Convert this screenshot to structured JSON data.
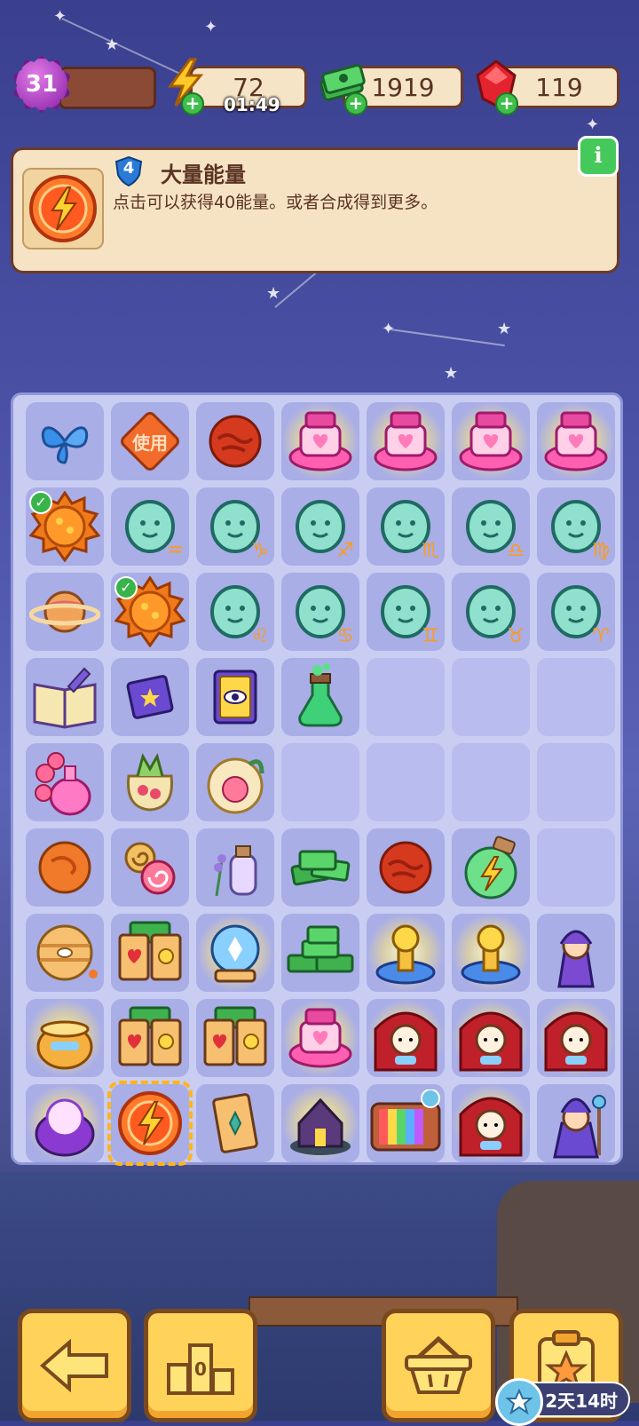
{
  "top_bar": {
    "level": "31",
    "energy": "72",
    "energy_timer": "01:49",
    "cash": "1919",
    "gems": "119"
  },
  "info_panel": {
    "item_level": "4",
    "title": "大量能量",
    "description": "点击可以获得40能量。或者合成得到更多。",
    "info_button": "i"
  },
  "board": {
    "rows": [
      [
        {
          "name": "blue-butterfly",
          "icon": "butterfly"
        },
        {
          "name": "use-card",
          "icon": "ticket",
          "text": "使用"
        },
        {
          "name": "red-planet",
          "icon": "planet-red"
        },
        {
          "name": "pink-heart-chest",
          "icon": "chest",
          "glow": true
        },
        {
          "name": "pink-heart-chest",
          "icon": "chest",
          "glow": true
        },
        {
          "name": "pink-heart-chest",
          "icon": "chest",
          "glow": true
        },
        {
          "name": "pink-heart-chest",
          "icon": "chest",
          "glow": true
        }
      ],
      [
        {
          "name": "sun",
          "icon": "sun",
          "check": true
        },
        {
          "name": "aquarius-statue",
          "icon": "zodiac",
          "symbol": "♒"
        },
        {
          "name": "capricorn-statue",
          "icon": "zodiac",
          "symbol": "♑"
        },
        {
          "name": "sagittarius-statue",
          "icon": "zodiac",
          "symbol": "♐"
        },
        {
          "name": "scorpio-statue",
          "icon": "zodiac",
          "symbol": "♏"
        },
        {
          "name": "libra-statue",
          "icon": "zodiac",
          "symbol": "♎"
        },
        {
          "name": "virgo-statue",
          "icon": "zodiac",
          "symbol": "♍"
        }
      ],
      [
        {
          "name": "saturn",
          "icon": "saturn"
        },
        {
          "name": "sun",
          "icon": "sun",
          "check": true
        },
        {
          "name": "leo-statue",
          "icon": "zodiac",
          "symbol": "♌"
        },
        {
          "name": "cancer-statue",
          "icon": "zodiac",
          "symbol": "♋"
        },
        {
          "name": "gemini-statue",
          "icon": "zodiac",
          "symbol": "♊"
        },
        {
          "name": "taurus-statue",
          "icon": "zodiac",
          "symbol": "♉"
        },
        {
          "name": "aries-statue",
          "icon": "zodiac",
          "symbol": "♈"
        }
      ],
      [
        {
          "name": "magic-book-open",
          "icon": "book-open"
        },
        {
          "name": "purple-book",
          "icon": "book"
        },
        {
          "name": "eye-book",
          "icon": "eye-book"
        },
        {
          "name": "green-potion",
          "icon": "potion-green"
        },
        {
          "name": "empty",
          "empty": true
        },
        {
          "name": "empty",
          "empty": true
        },
        {
          "name": "empty",
          "empty": true
        }
      ],
      [
        {
          "name": "rose-perfume",
          "icon": "perfume"
        },
        {
          "name": "flower-sachet",
          "icon": "sachet"
        },
        {
          "name": "flower-globe",
          "icon": "globe-flower"
        },
        {
          "name": "empty",
          "empty": true
        },
        {
          "name": "empty",
          "empty": true
        },
        {
          "name": "empty",
          "empty": true
        },
        {
          "name": "empty",
          "empty": true
        }
      ],
      [
        {
          "name": "orange-planet",
          "icon": "planet-orange"
        },
        {
          "name": "swirl-candies",
          "icon": "candy"
        },
        {
          "name": "lavender-bottle",
          "icon": "lavender"
        },
        {
          "name": "cash-stack",
          "icon": "cash"
        },
        {
          "name": "red-planet",
          "icon": "planet-red"
        },
        {
          "name": "energy-potion",
          "icon": "energy-potion"
        },
        {
          "name": "empty",
          "empty": true
        }
      ],
      [
        {
          "name": "jupiter",
          "icon": "jupiter"
        },
        {
          "name": "tarot-cards",
          "icon": "tarot"
        },
        {
          "name": "crystal-ball",
          "icon": "crystal",
          "glow": true
        },
        {
          "name": "cash-pile",
          "icon": "cash-big"
        },
        {
          "name": "golden-fountain",
          "icon": "fountain",
          "glow": true
        },
        {
          "name": "golden-fountain",
          "icon": "fountain",
          "glow": true
        },
        {
          "name": "fortune-teller",
          "icon": "witch"
        }
      ],
      [
        {
          "name": "golden-cauldron",
          "icon": "cauldron",
          "glow": true
        },
        {
          "name": "tarot-cards",
          "icon": "tarot"
        },
        {
          "name": "tarot-cards",
          "icon": "tarot"
        },
        {
          "name": "pink-heart-chest",
          "icon": "chest",
          "glow": true
        },
        {
          "name": "fortune-booth",
          "icon": "booth",
          "glow": true
        },
        {
          "name": "fortune-booth",
          "icon": "booth",
          "glow": true
        },
        {
          "name": "fortune-booth",
          "icon": "booth",
          "glow": true
        }
      ],
      [
        {
          "name": "magic-cauldron",
          "icon": "cauldron-purple",
          "glow": true
        },
        {
          "name": "energy-orb",
          "icon": "energy",
          "selected": true
        },
        {
          "name": "tarot-card",
          "icon": "card-single"
        },
        {
          "name": "haunted-house",
          "icon": "house",
          "glow": true
        },
        {
          "name": "retro-tv",
          "icon": "tv"
        },
        {
          "name": "fortune-booth",
          "icon": "booth",
          "glow": true
        },
        {
          "name": "wizard",
          "icon": "wizard"
        }
      ]
    ]
  },
  "bottom": {
    "event_timer": "2天14时"
  },
  "colors": {
    "accent": "#ffd35a",
    "panel": "#f6e3c4",
    "board": "#c9cdf2",
    "cell": "#a9aee7"
  }
}
